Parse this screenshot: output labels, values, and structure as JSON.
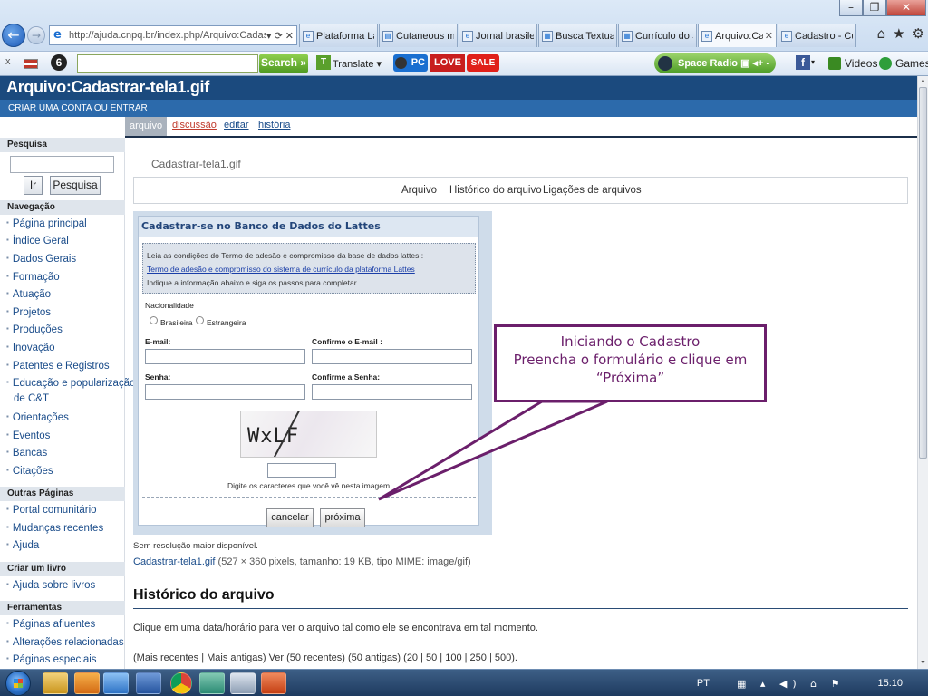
{
  "window": {
    "minimize": "–",
    "maximize": "❐",
    "close": "✕"
  },
  "browser": {
    "url": "http://ajuda.cnpq.br/index.php/Arquivo:Cadastrar-",
    "url_tools": [
      "▾",
      "⟳",
      "✕"
    ],
    "tabs": [
      {
        "label": "Plataforma Lat..."
      },
      {
        "label": "Cutaneous ma..."
      },
      {
        "label": "Jornal brasileir..."
      },
      {
        "label": "Busca Textual ..."
      },
      {
        "label": "Currículo do Si..."
      },
      {
        "label": "Arquivo:Ca...",
        "active": true,
        "close": "✕"
      },
      {
        "label": "Cadastro - Cur..."
      }
    ],
    "tool_icons": [
      "⌂",
      "★",
      "⚙"
    ],
    "toolbar": {
      "close": "x",
      "six": "6",
      "search_button": "Search »",
      "translate_label": "Translate ▾",
      "pc_badge": "PC",
      "love_badge": "LOVE",
      "sale_badge": "SALE",
      "radio_label": "Space Radio ▣ ◂+ -",
      "fb_letter": "f",
      "videos_label": "Videos",
      "games_label": "Games"
    }
  },
  "wiki": {
    "page_heading": "Arquivo:Cadastrar-tela1.gif",
    "account_link": "CRIAR UMA CONTA OU ENTRAR",
    "ns_tabs": {
      "arquivo": "arquivo",
      "discussao": "discussão",
      "editar": "editar",
      "historia": "história"
    },
    "sidebar": {
      "search_heading": "Pesquisa",
      "go_button": "Ir",
      "search_button": "Pesquisa",
      "nav_heading": "Navegação",
      "nav_items": [
        "Página principal",
        "Índice Geral",
        "Dados Gerais",
        "Formação",
        "Atuação",
        "Projetos",
        "Produções",
        "Inovação",
        "Patentes e Registros",
        "Educação e popularização",
        "de C&T",
        "Orientações",
        "Eventos",
        "Bancas",
        "Citações"
      ],
      "other_heading": "Outras Páginas",
      "other_items": [
        "Portal comunitário",
        "Mudanças recentes",
        "Ajuda"
      ],
      "book_heading": "Criar um livro",
      "book_items": [
        "Ajuda sobre livros"
      ],
      "tools_heading": "Ferramentas",
      "tools_items": [
        "Páginas afluentes",
        "Alterações relacionadas",
        "Páginas especiais"
      ]
    },
    "file_title": "Cadastrar-tela1.gif",
    "file_tabs": [
      "Arquivo",
      "Histórico do arquivo",
      "Ligações de arquivos"
    ],
    "form_image": {
      "title": "Cadastrar-se no Banco de Dados do Lattes",
      "terms_line1": "Leia as condições do Termo de adesão e compromisso da base de dados lattes :",
      "terms_link": "Termo de adesão e compromisso do sistema de currículo da plataforma Lattes",
      "terms_line3": "Indique a informação abaixo e siga os passos para completar.",
      "nationality_label": "Nacionalidade",
      "nationality_options": [
        "Brasileira",
        "Estrangeira"
      ],
      "email_label": "E-mail:",
      "confirm_email_label": "Confirme o E-mail :",
      "password_label": "Senha:",
      "confirm_password_label": "Confirme a Senha:",
      "captcha_text": "WxLF",
      "captcha_hint": "Digite os caracteres que você vê nesta imagem",
      "cancel_button": "cancelar",
      "next_button": "próxima"
    },
    "no_resolution": "Sem resolução maior disponível.",
    "file_link": "Cadastrar-tela1.gif",
    "file_info": " (527 × 360 pixels, tamanho: 19 KB, tipo MIME: image/gif)",
    "history_heading": "Histórico do arquivo",
    "history_desc": "Clique em uma data/horário para ver o arquivo tal como ele se encontrava em tal momento.",
    "history_nav": "(Mais recentes | Mais antigas) Ver (50 recentes) (50 antigas) (20 | 50 | 100 | 250 | 500)."
  },
  "callout": {
    "line1": "Iniciando o Cadastro",
    "line2": "Preencha o formulário e clique em",
    "line3": "“Próxima”",
    "color": "#6b1f6b"
  },
  "taskbar": {
    "language": "PT",
    "tray_icons": "▦ ▴ ◀) ⌂ ⚑",
    "clock": "15:10"
  }
}
